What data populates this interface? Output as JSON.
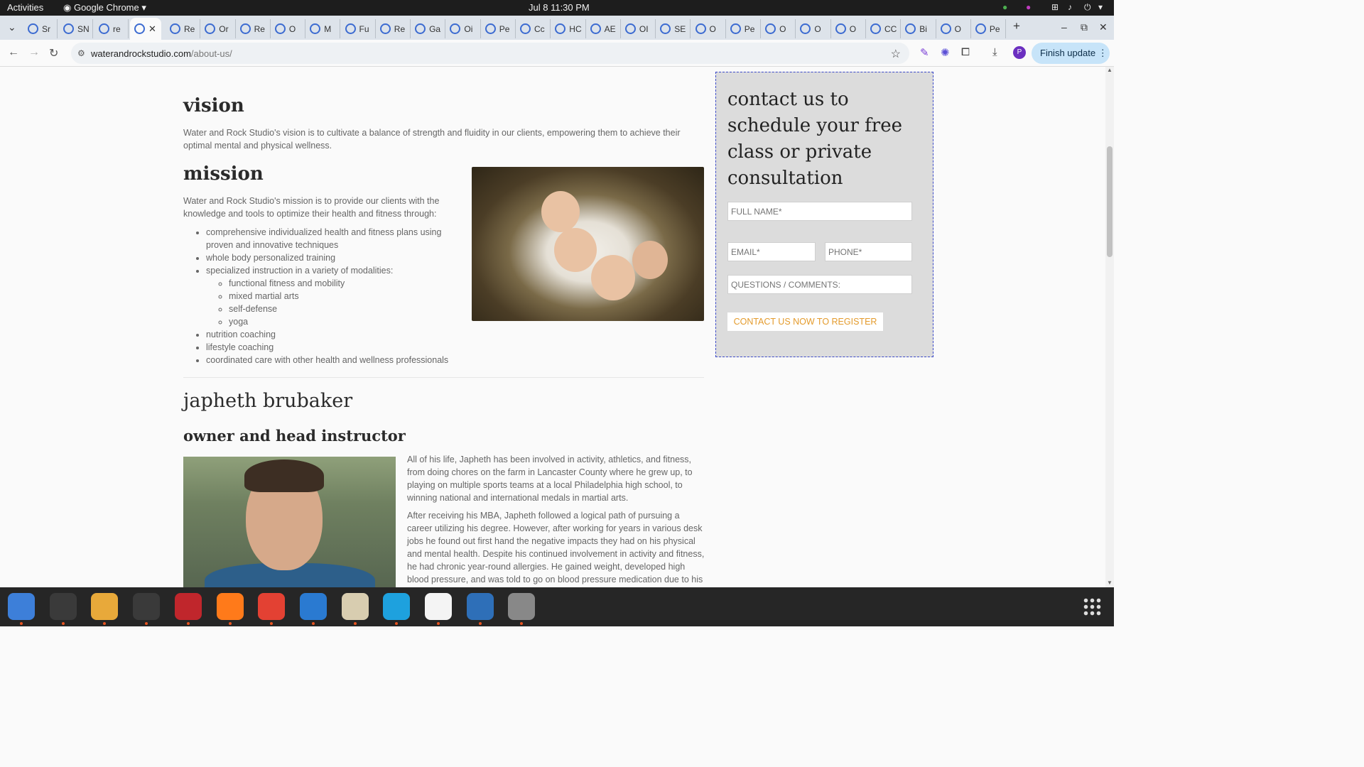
{
  "system_bar": {
    "activities": "Activities",
    "app_name": "Google Chrome",
    "datetime": "Jul 8  11:30 PM"
  },
  "tabs": [
    {
      "label": "Sr"
    },
    {
      "label": "SN"
    },
    {
      "label": "re"
    },
    {
      "label": "",
      "active": true
    },
    {
      "label": "Re"
    },
    {
      "label": "Or"
    },
    {
      "label": "Re"
    },
    {
      "label": "O"
    },
    {
      "label": "M"
    },
    {
      "label": "Fu"
    },
    {
      "label": "Re"
    },
    {
      "label": "Ga"
    },
    {
      "label": "Oi"
    },
    {
      "label": "Pe"
    },
    {
      "label": "Cc"
    },
    {
      "label": "HC"
    },
    {
      "label": "AE"
    },
    {
      "label": "OI"
    },
    {
      "label": "SE"
    },
    {
      "label": "O"
    },
    {
      "label": "Pe"
    },
    {
      "label": "O"
    },
    {
      "label": "O"
    },
    {
      "label": "O"
    },
    {
      "label": "CC"
    },
    {
      "label": "Bi"
    },
    {
      "label": "O"
    },
    {
      "label": "Pe"
    }
  ],
  "toolbar": {
    "url_domain": "waterandrockstudio.com",
    "url_path": "/about-us/",
    "profile_initial": "P",
    "finish_update": "Finish update"
  },
  "page": {
    "vision_heading": "vision",
    "vision_text": "Water and Rock Studio's vision is to cultivate a balance of strength and fluidity in our clients, empowering them to achieve their optimal mental and physical wellness.",
    "mission_heading": "mission",
    "mission_text": "Water and Rock Studio's mission is to provide our clients with the knowledge and tools to optimize their health and fitness through:",
    "mission_items": [
      "comprehensive individualized health and fitness plans using proven and innovative techniques",
      "whole body personalized training",
      "specialized instruction in a variety of modalities:",
      "nutrition coaching",
      "lifestyle coaching",
      "coordinated care with other health and wellness professionals"
    ],
    "modalities": [
      "functional fitness and mobility",
      "mixed martial arts",
      "self-defense",
      "yoga"
    ],
    "person_name": "japheth brubaker",
    "person_role": "owner and head instructor",
    "bio_paragraph_1": "All of his life, Japheth has been involved in activity, athletics, and fitness, from doing chores on the farm in Lancaster County where he grew up, to playing on multiple sports teams at a local Philadelphia high school, to winning national and international medals in martial arts.",
    "bio_paragraph_2": "After receiving his MBA, Japheth followed a logical path of pursuing a career utilizing his degree. However, after working for years in various desk jobs he found out first hand the negative impacts they had on his physical and mental health. Despite his continued involvement in activity and fitness, he had chronic year-round allergies. He gained weight, developed high blood pressure, and was told to go on blood pressure medication due to his sedentary work environment. He also"
  },
  "contact_form": {
    "heading": "contact us to schedule your free class or private consultation",
    "full_name_placeholder": "FULL NAME*",
    "email_placeholder": "EMAIL*",
    "phone_placeholder": "PHONE*",
    "comments_placeholder": "QUESTIONS / COMMENTS:",
    "submit_label": "CONTACT US NOW TO REGISTER"
  },
  "colors": {
    "accent_button_text": "#e49b2c",
    "form_border": "#3b49c9",
    "tab_strip": "#dde3ea"
  },
  "dock_apps": [
    "thunderbird-icon",
    "terminal-icon",
    "calculator-icon",
    "system-monitor-icon",
    "filezilla-icon",
    "firefox-icon",
    "chrome-icon",
    "vscode-icon",
    "files-icon",
    "skype-icon",
    "text-editor-icon",
    "document-viewer-icon",
    "disk-icon"
  ]
}
